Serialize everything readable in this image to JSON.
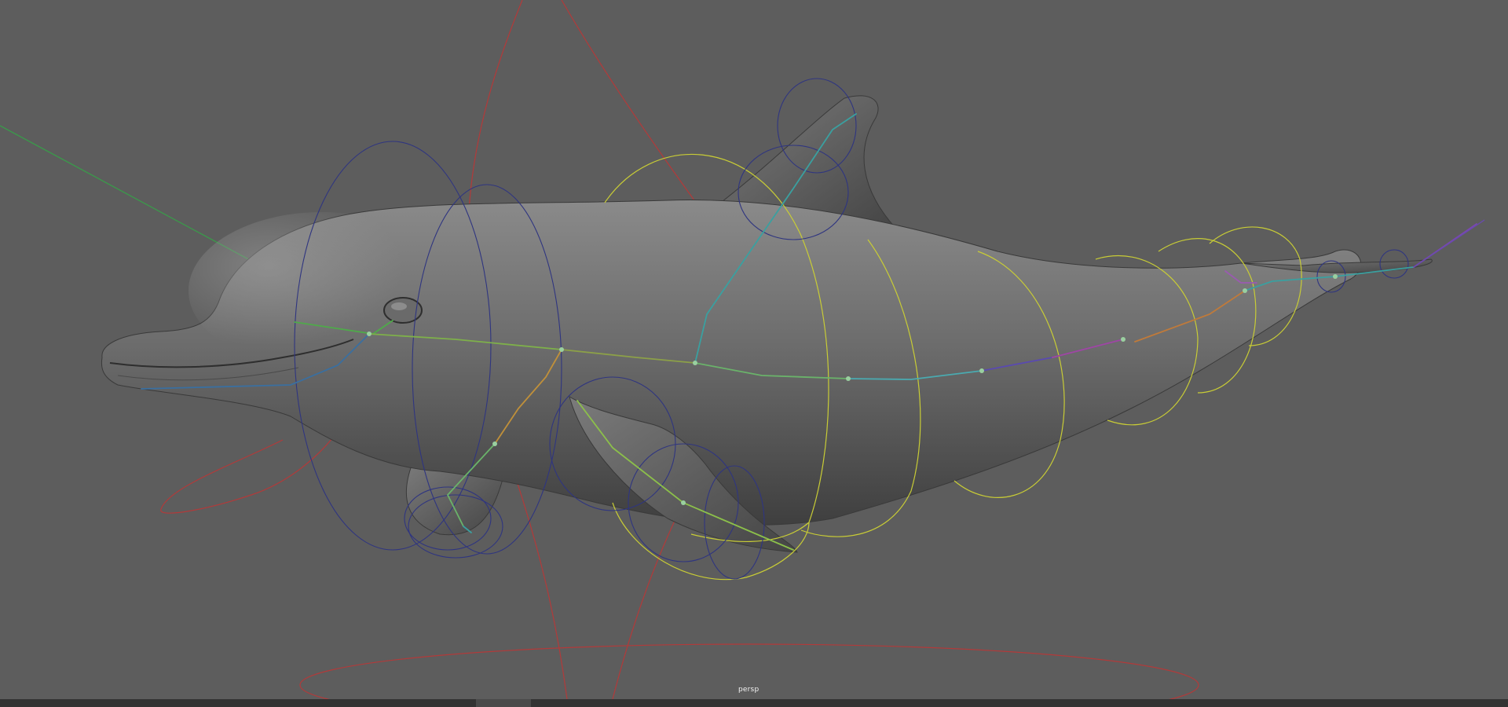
{
  "viewport": {
    "camera_label": "persp",
    "background_color": "#5d5d5d",
    "mesh": {
      "name": "dolphin",
      "color": "#6e6e6e"
    },
    "colors": {
      "red_control": "#b23a3a",
      "yellow_control": "#c8cc36",
      "navy_control": "#2f3580",
      "green_axis": "#3a9a4a"
    }
  },
  "status_bar": {
    "color": "#333333"
  }
}
